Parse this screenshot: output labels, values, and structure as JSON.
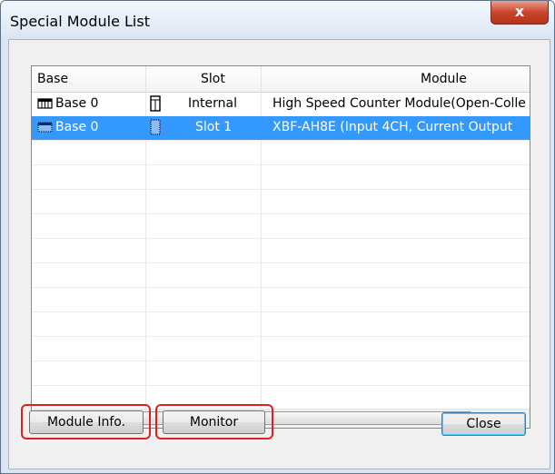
{
  "window": {
    "title": "Special Module List",
    "close_glyph": "x"
  },
  "list": {
    "columns": [
      "Base",
      "Slot",
      "Module"
    ],
    "rows": [
      {
        "base": "Base 0",
        "slot": "Internal",
        "module": "High Speed Counter Module(Open-Colle",
        "selected": false,
        "base_icon": "base-icon",
        "slot_icon": "slot-icon"
      },
      {
        "base": "Base 0",
        "slot": "Slot 1",
        "module": "XBF-AH8E (Input 4CH, Current Output",
        "selected": true,
        "base_icon": "base-icon",
        "slot_icon": "slot-icon"
      }
    ],
    "scroll_left": "◄",
    "scroll_right": "►",
    "scroll_grip": "III"
  },
  "buttons": {
    "module_info": "Module Info.",
    "monitor": "Monitor",
    "close": "Close"
  },
  "colors": {
    "selection": "#3399ff",
    "highlight": "#e02020"
  }
}
